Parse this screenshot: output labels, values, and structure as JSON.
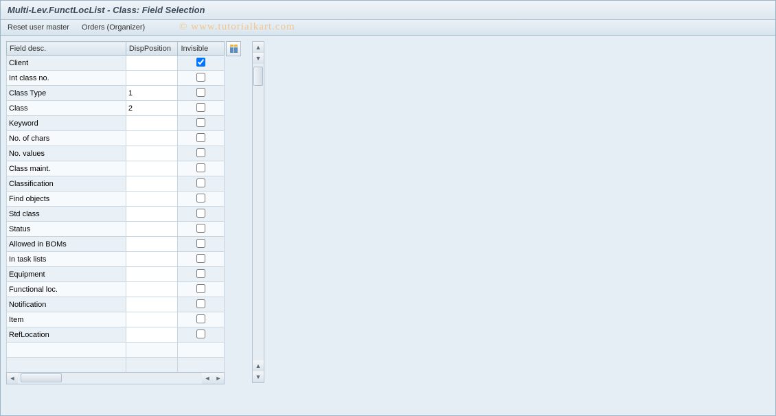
{
  "title": "Multi-Lev.FunctLocList - Class: Field Selection",
  "toolbar": {
    "reset_user_master": "Reset user master",
    "orders_organizer": "Orders (Organizer)"
  },
  "watermark": "© www.tutorialkart.com",
  "table": {
    "headers": {
      "field_desc": "Field desc.",
      "disp_position": "DispPosition",
      "invisible": "Invisible"
    },
    "rows": [
      {
        "field_desc": "Client",
        "disp_position": "",
        "invisible": true
      },
      {
        "field_desc": "Int class no.",
        "disp_position": "",
        "invisible": false
      },
      {
        "field_desc": "Class Type",
        "disp_position": "1",
        "invisible": false
      },
      {
        "field_desc": "Class",
        "disp_position": "2",
        "invisible": false
      },
      {
        "field_desc": "Keyword",
        "disp_position": "",
        "invisible": false
      },
      {
        "field_desc": "No. of chars",
        "disp_position": "",
        "invisible": false
      },
      {
        "field_desc": "No. values",
        "disp_position": "",
        "invisible": false
      },
      {
        "field_desc": "Class maint.",
        "disp_position": "",
        "invisible": false
      },
      {
        "field_desc": "Classification",
        "disp_position": "",
        "invisible": false
      },
      {
        "field_desc": "Find objects",
        "disp_position": "",
        "invisible": false
      },
      {
        "field_desc": "Std class",
        "disp_position": "",
        "invisible": false
      },
      {
        "field_desc": "Status",
        "disp_position": "",
        "invisible": false
      },
      {
        "field_desc": "Allowed in BOMs",
        "disp_position": "",
        "invisible": false
      },
      {
        "field_desc": "In task lists",
        "disp_position": "",
        "invisible": false
      },
      {
        "field_desc": "Equipment",
        "disp_position": "",
        "invisible": false
      },
      {
        "field_desc": "Functional loc.",
        "disp_position": "",
        "invisible": false
      },
      {
        "field_desc": "Notification",
        "disp_position": "",
        "invisible": false
      },
      {
        "field_desc": "Item",
        "disp_position": "",
        "invisible": false
      },
      {
        "field_desc": "RefLocation",
        "disp_position": "",
        "invisible": false
      }
    ],
    "empty_rows": 2
  },
  "icons": {
    "table_settings": "table-settings-icon"
  }
}
